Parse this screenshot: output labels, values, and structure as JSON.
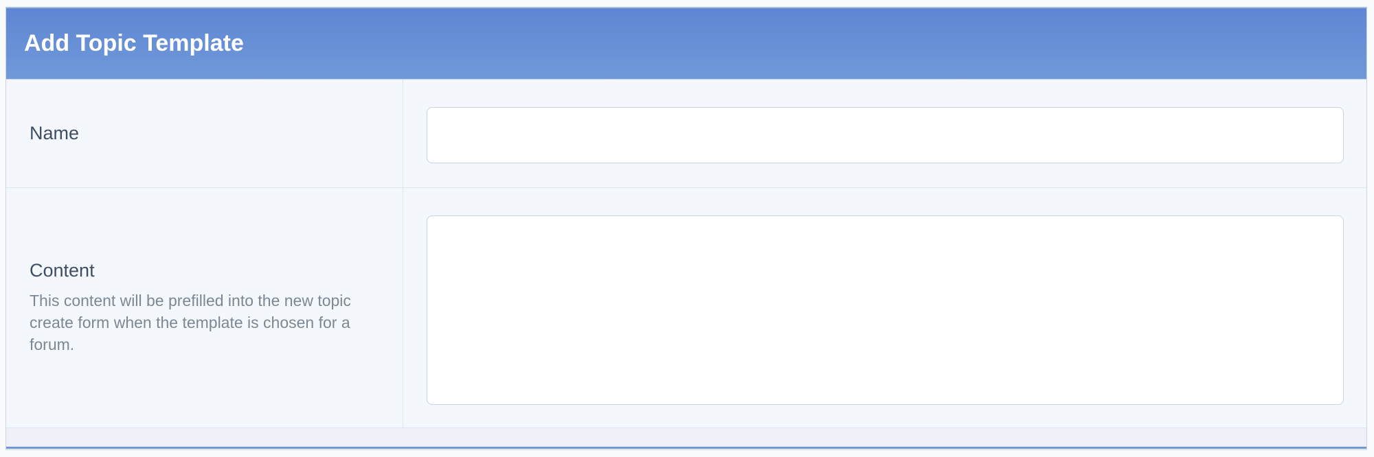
{
  "header": {
    "title": "Add Topic Template"
  },
  "fields": {
    "name": {
      "label": "Name",
      "value": "",
      "placeholder": ""
    },
    "content": {
      "label": "Content",
      "description": "This content will be prefilled into the new topic create form when the template is chosen for a forum.",
      "value": "",
      "placeholder": ""
    }
  },
  "colors": {
    "header_gradient_top": "#5f86d3",
    "header_gradient_bottom": "#7099d9",
    "panel_background": "#f4f8fc",
    "label_text": "#3f4e63",
    "description_text": "#7d8793"
  }
}
